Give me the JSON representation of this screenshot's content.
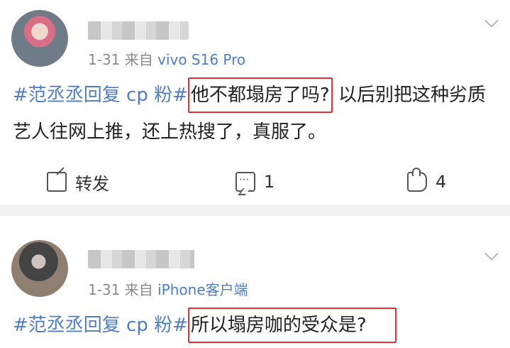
{
  "posts": [
    {
      "time": "1-31",
      "source_prefix": "来自",
      "source": "vivo S16 Pro",
      "hashtag": "#范丞丞回复 cp 粉#",
      "highlight": "他不都塌房了吗?",
      "text": " 以后别把这种劣质艺人往网上推，还上热搜了，真服了。",
      "actions": {
        "forward_label": "转发",
        "comment_count": "1",
        "like_count": "4"
      }
    },
    {
      "time": "1-31",
      "source_prefix": "来自",
      "source": "iPhone客户端",
      "hashtag": "#范丞丞回复 cp 粉#",
      "highlight": "所以塌房咖的受众是?"
    }
  ],
  "icons": {
    "forward": "forward-icon",
    "comment": "comment-icon",
    "like": "like-icon",
    "expand": "chevron-down-icon"
  },
  "colors": {
    "link_blue": "#4f7dc2",
    "highlight_red": "#e62f3a",
    "meta_gray": "#8a8a8a"
  }
}
